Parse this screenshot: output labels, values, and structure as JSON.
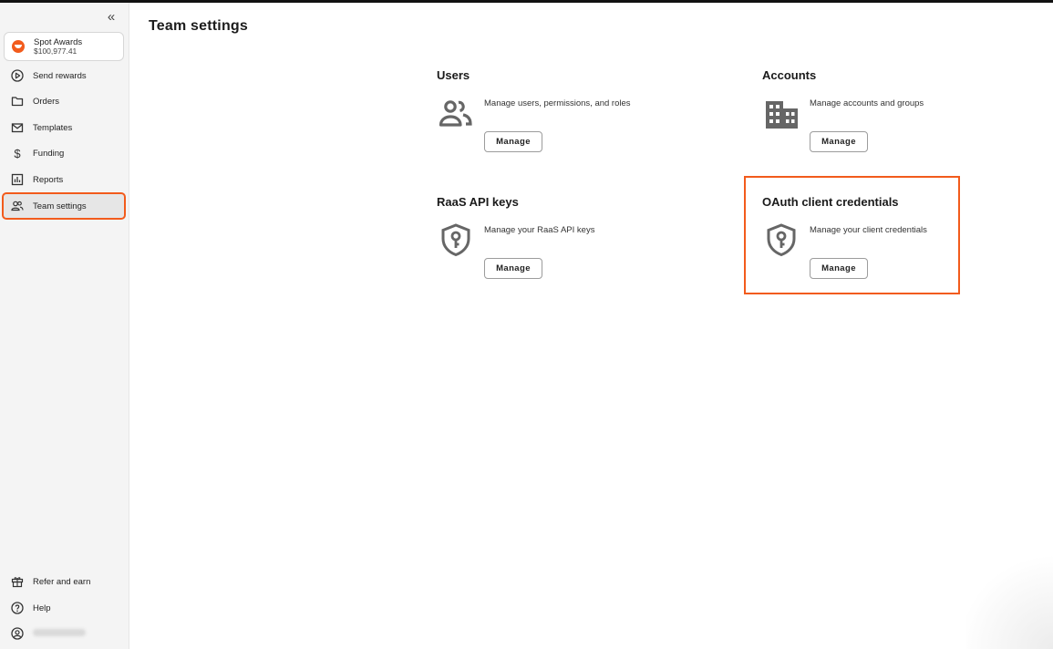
{
  "sidebar": {
    "collapse_icon": "double-chevron-left",
    "account": {
      "name": "Spot Awards",
      "balance": "$100,977.41"
    },
    "items": [
      {
        "label": "Send rewards",
        "icon": "play-circle-icon"
      },
      {
        "label": "Orders",
        "icon": "folder-icon"
      },
      {
        "label": "Templates",
        "icon": "envelope-icon"
      },
      {
        "label": "Funding",
        "icon": "dollar-icon"
      },
      {
        "label": "Reports",
        "icon": "chart-icon"
      },
      {
        "label": "Team settings",
        "icon": "team-icon",
        "active": true
      }
    ],
    "bottom_items": [
      {
        "label": "Refer and earn",
        "icon": "gift-icon"
      },
      {
        "label": "Help",
        "icon": "help-icon"
      },
      {
        "label": "",
        "icon": "user-icon"
      }
    ]
  },
  "main": {
    "title": "Team settings",
    "cards": [
      {
        "title": "Users",
        "description": "Manage users, permissions, and roles",
        "button": "Manage",
        "icon": "users-icon"
      },
      {
        "title": "Accounts",
        "description": "Manage accounts and groups",
        "button": "Manage",
        "icon": "building-icon"
      },
      {
        "title": "RaaS API keys",
        "description": "Manage your RaaS API keys",
        "button": "Manage",
        "icon": "shield-key-icon"
      },
      {
        "title": "OAuth client credentials",
        "description": "Manage your client credentials",
        "button": "Manage",
        "icon": "shield-key-icon"
      }
    ]
  },
  "colors": {
    "accent": "#f25b1c",
    "sidebar_bg": "#f4f4f4",
    "icon_gray": "#666666"
  }
}
